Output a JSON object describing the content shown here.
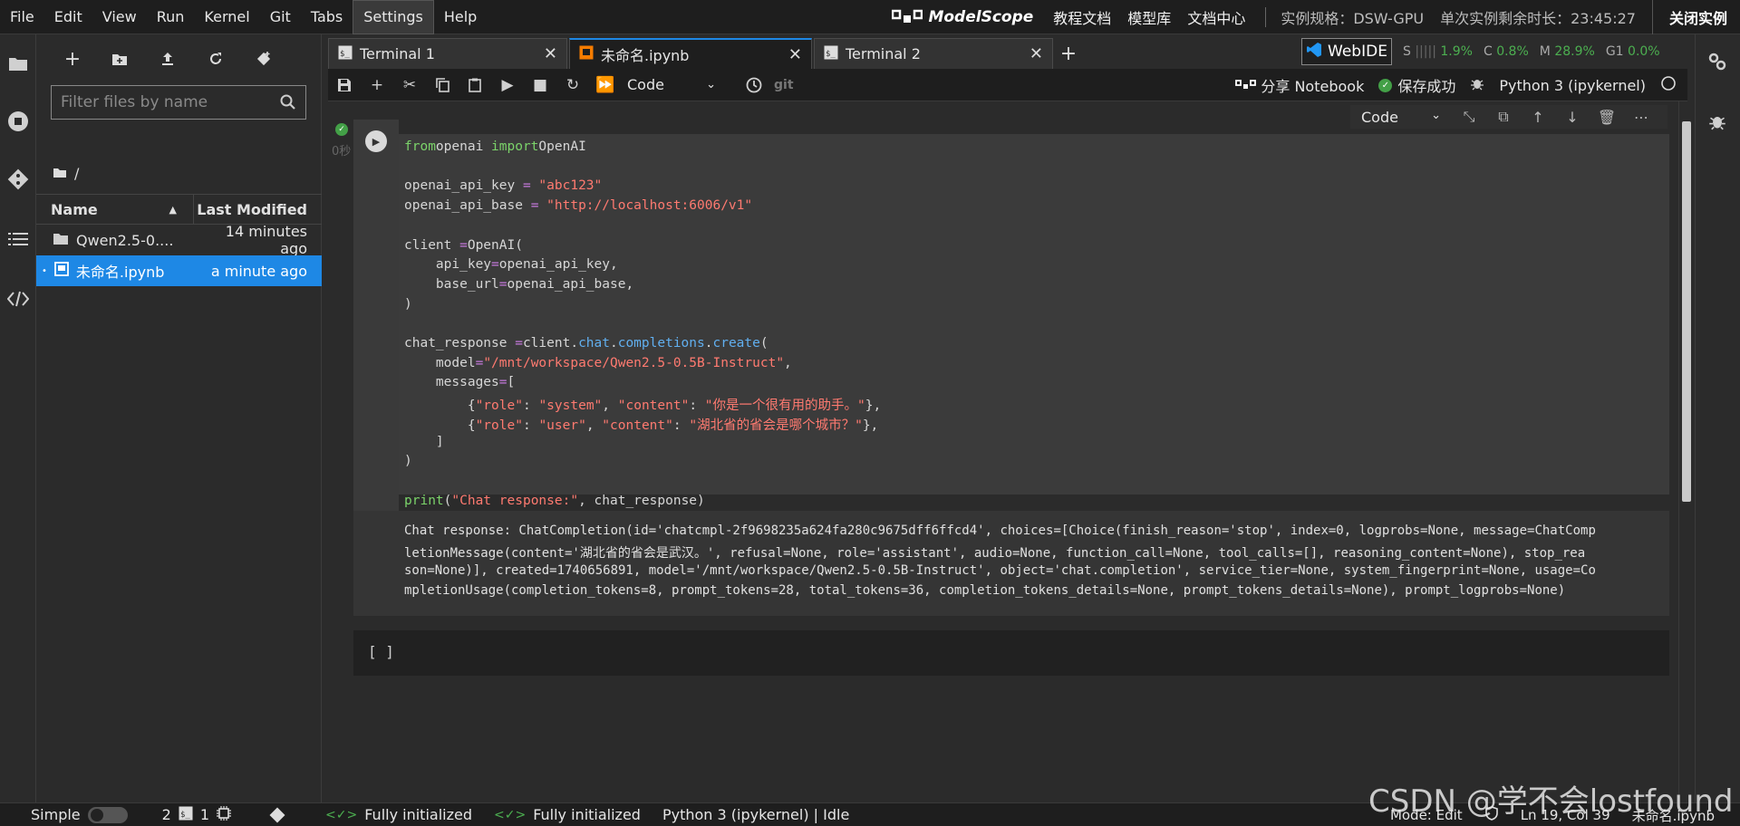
{
  "menubar": {
    "items": [
      "File",
      "Edit",
      "View",
      "Run",
      "Kernel",
      "Git",
      "Tabs",
      "Settings",
      "Help"
    ],
    "active": "Settings"
  },
  "top_right": {
    "brand": "ModelScope",
    "links": [
      "教程文档",
      "模型库",
      "文档中心"
    ],
    "spec": "实例规格：DSW-GPU",
    "remaining": "单次实例剩余时长：23:45:27",
    "close_instance": "关闭实例"
  },
  "file_panel": {
    "filter_placeholder": "Filter files by name",
    "breadcrumb": "/",
    "header_name": "Name",
    "header_modified": "Last Modified",
    "files": [
      {
        "name": "Qwen2.5-0....",
        "modified": "14 minutes ago",
        "type": "folder",
        "selected": false
      },
      {
        "name": "未命名.ipynb",
        "modified": "a minute ago",
        "type": "notebook",
        "selected": true
      }
    ]
  },
  "tabs": [
    {
      "label": "Terminal 1",
      "active": false,
      "icon": "terminal-icon"
    },
    {
      "label": "未命名.ipynb",
      "active": true,
      "icon": "notebook-icon"
    },
    {
      "label": "Terminal 2",
      "active": false,
      "icon": "terminal-icon"
    }
  ],
  "webide": {
    "label": "WebIDE"
  },
  "metrics": {
    "s_label": "S",
    "s_value": "1.9%",
    "c_label": "C",
    "c_value": "0.8%",
    "m_label": "M",
    "m_value": "28.9%",
    "g_label": "G1",
    "g_value": "0.0%"
  },
  "toolbar": {
    "cell_type": "Code",
    "git_label": "git",
    "share_label": "分享 Notebook",
    "saved_label": "保存成功",
    "kernel_label": "Python 3 (ipykernel)"
  },
  "cell_toolbar": {
    "cell_type": "Code"
  },
  "cell1": {
    "exec_time": "0秒",
    "code": [
      [
        [
          "kw",
          "from"
        ],
        [
          "",
          "openai "
        ],
        [
          "kw",
          "import"
        ],
        [
          "",
          "OpenAI"
        ]
      ],
      [],
      [
        [
          "",
          "openai_api_key "
        ],
        [
          "op",
          "="
        ],
        [
          "str",
          " \"abc123\""
        ]
      ],
      [
        [
          "",
          "openai_api_base "
        ],
        [
          "op",
          "="
        ],
        [
          "str",
          " \"http://localhost:6006/v1\""
        ]
      ],
      [],
      [
        [
          "",
          "client "
        ],
        [
          "op",
          "="
        ],
        [
          "",
          "OpenAI("
        ]
      ],
      [
        [
          "",
          "    api_key"
        ],
        [
          "op",
          "="
        ],
        [
          "",
          "openai_api_key,"
        ]
      ],
      [
        [
          "",
          "    base_url"
        ],
        [
          "op",
          "="
        ],
        [
          "",
          "openai_api_base,"
        ]
      ],
      [
        [
          "",
          ")"
        ]
      ],
      [],
      [
        [
          "",
          "chat_response "
        ],
        [
          "op",
          "="
        ],
        [
          "",
          "client."
        ],
        [
          "at",
          "chat"
        ],
        [
          "",
          "."
        ],
        [
          "at",
          "completions"
        ],
        [
          "",
          "."
        ],
        [
          "at",
          "create"
        ],
        [
          "",
          "("
        ]
      ],
      [
        [
          "",
          "    model"
        ],
        [
          "op",
          "="
        ],
        [
          "str",
          "\"/mnt/workspace/Qwen2.5-0.5B-Instruct\""
        ],
        [
          "",
          ","
        ]
      ],
      [
        [
          "",
          "    messages"
        ],
        [
          "op",
          "="
        ],
        [
          "",
          "["
        ]
      ],
      [
        [
          "",
          "        {"
        ],
        [
          "str",
          "\"role\""
        ],
        [
          "",
          ": "
        ],
        [
          "str",
          "\"system\""
        ],
        [
          "",
          ", "
        ],
        [
          "str",
          "\"content\""
        ],
        [
          "",
          ": "
        ],
        [
          "str",
          "\"你是一个很有用的助手。\""
        ],
        [
          "",
          "},"
        ]
      ],
      [
        [
          "",
          "        {"
        ],
        [
          "str",
          "\"role\""
        ],
        [
          "",
          ": "
        ],
        [
          "str",
          "\"user\""
        ],
        [
          "",
          ", "
        ],
        [
          "str",
          "\"content\""
        ],
        [
          "",
          ": "
        ],
        [
          "str",
          "\"湖北省的省会是哪个城市？\""
        ],
        [
          "",
          "},"
        ]
      ],
      [
        [
          "",
          "    ]"
        ]
      ],
      [
        [
          "",
          ")"
        ]
      ],
      [],
      [
        [
          "fn",
          "print"
        ],
        [
          "",
          "("
        ],
        [
          "str",
          "\"Chat response:\""
        ],
        [
          "",
          ", chat_response)"
        ]
      ]
    ]
  },
  "output1": {
    "lines": [
      "Chat response: ChatCompletion(id='chatcmpl-2f9698235a624fa280c9675dff6ffcd4', choices=[Choice(finish_reason='stop', index=0, logprobs=None, message=ChatComp",
      "letionMessage(content='湖北省的省会是武汉。', refusal=None, role='assistant', audio=None, function_call=None, tool_calls=[], reasoning_content=None), stop_rea",
      "son=None)], created=1740656891, model='/mnt/workspace/Qwen2.5-0.5B-Instruct', object='chat.completion', service_tier=None, system_fingerprint=None, usage=Co",
      "mpletionUsage(completion_tokens=8, prompt_tokens=28, total_tokens=36, completion_tokens_details=None, prompt_tokens_details=None), prompt_logprobs=None)"
    ]
  },
  "cell2": {
    "prompt": "[ ]"
  },
  "statusbar": {
    "mode_simple": "Simple",
    "count_a": "2",
    "count_b": "1",
    "init1": "Fully initialized",
    "init2": "Fully initialized",
    "kernel_status": "Python 3 (ipykernel) | Idle",
    "mode": "Mode: Edit",
    "position": "Ln 19, Col 39",
    "filename": "未命名.ipynb"
  },
  "watermark": "CSDN @学不会lostfound"
}
